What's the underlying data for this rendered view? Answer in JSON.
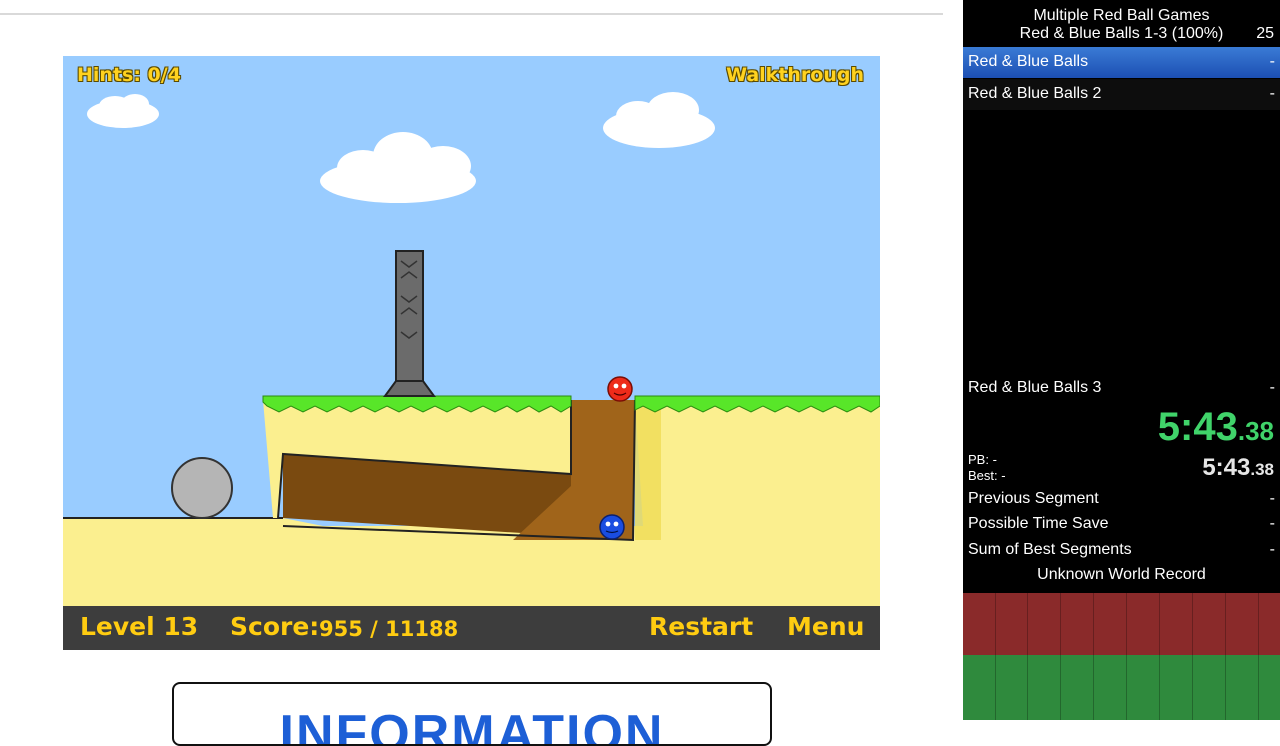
{
  "game": {
    "hints": "Hints: 0/4",
    "walkthrough": "Walkthrough",
    "level": "Level 13",
    "score_label": "Score:",
    "score_value": "955 / 11188",
    "restart": "Restart",
    "menu": "Menu"
  },
  "page": {
    "info_title": "INFORMATION"
  },
  "splits": {
    "game_title": "Multiple Red Ball Games",
    "category": "Red & Blue Balls 1-3 (100%)",
    "attempts": "25",
    "segments": [
      {
        "name": "Red & Blue Balls",
        "time": "-"
      },
      {
        "name": "Red & Blue Balls 2",
        "time": "-"
      },
      {
        "name": "Red & Blue Balls 3",
        "time": "-"
      }
    ],
    "timer_main": "5:43",
    "timer_cs": ".38",
    "pb_label": "PB:",
    "pb_value": "-",
    "best_label": "Best:",
    "best_value": "-",
    "seg_timer_main": "5:43",
    "seg_timer_cs": ".38",
    "previous_segment_label": "Previous Segment",
    "previous_segment_value": "-",
    "possible_time_save_label": "Possible Time Save",
    "possible_time_save_value": "-",
    "sum_of_best_label": "Sum of Best Segments",
    "sum_of_best_value": "-",
    "world_record": "Unknown World Record"
  },
  "colors": {
    "sky": "#99ccff",
    "sand": "#fbef8f",
    "dirt": "#7a4a10",
    "grass": "#58e629",
    "hud_yellow": "#ffcc11",
    "timer_green": "#40d36a",
    "active_split": "#2a63c4"
  }
}
